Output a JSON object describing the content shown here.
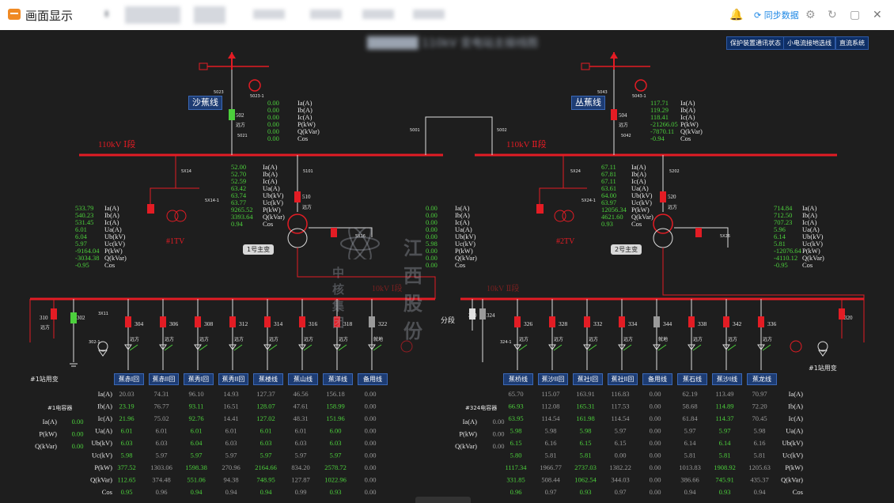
{
  "app": {
    "title": "画面显示"
  },
  "toolbar": {
    "sync_label": "同步数据"
  },
  "top_buttons": [
    "保护装置通讯状态",
    "小电流接地选线",
    "直流系统"
  ],
  "watermark": {
    "main": "江西股份",
    "sub": "中核集团"
  },
  "colors": {
    "bus": "#e31c24",
    "text": "#e6e6e6",
    "value": "#4cd03c",
    "panel": "#1d3c73"
  },
  "lines": {
    "left": "沙蕉线",
    "right": "丛蕉线"
  },
  "bus": {
    "b110_1": "110kV Ⅰ段",
    "b110_2": "110kV Ⅱ段",
    "b10_1": "10kV Ⅰ段",
    "b10_2": "10kV Ⅱ段",
    "section": "分段"
  },
  "tv": {
    "left": "#1TV",
    "right": "#2TV"
  },
  "transformers": {
    "t1": "1号主变",
    "t2": "2号主变"
  },
  "station_xfmr": {
    "left": "#1站用变",
    "right": "#1站用变"
  },
  "capacitor": {
    "left": "#1电容器",
    "right": "#324电容器"
  },
  "measure_labels": [
    "Ia(A)",
    "Ib(A)",
    "Ic(A)",
    "Ua(A)",
    "Ub(kV)",
    "Uc(kV)",
    "P(kW)",
    "Q(kVar)",
    "Cos"
  ],
  "measure_labels_short": [
    "Ia(A)",
    "Ib(A)",
    "Ic(A)",
    "P(kW)",
    "Q(kVar)",
    "Cos"
  ],
  "measure_labels_cap": [
    "Ia(A)",
    "P(kW)",
    "Q(kVar)"
  ],
  "breakers": {
    "b502": "502",
    "b504": "504",
    "b510": "510",
    "b520": "520",
    "b310": "310",
    "b302": "302",
    "b300": "300",
    "b324": "324",
    "b320": "320"
  },
  "switch_labels": {
    "s5023": "5023",
    "s5023_1": "5023-1",
    "s5021": "5021",
    "s5043": "5043",
    "s5043_1": "5043-1",
    "s5042": "5042",
    "s5001": "5001",
    "s5002": "5002",
    "s5x14": "5X14",
    "s5x14_1": "5X14-1",
    "s5x24": "5X24",
    "s5x24_1": "5X24-1",
    "s5101": "5101",
    "s5202": "5202",
    "s5x16": "5X16",
    "s5x26": "5X26",
    "s3x11": "3X11",
    "s302_1": "302-1",
    "s324_1": "324-1"
  },
  "far_label": "远方",
  "ground_label": "就地",
  "values": {
    "v502": [
      "0.00",
      "0.00",
      "0.00",
      "0.00",
      "0.00",
      "0.00"
    ],
    "v504": [
      "117.71",
      "119.29",
      "118.41",
      "-21266.05",
      "-7870.11",
      "-0.94"
    ],
    "v510": [
      "52.00",
      "52.70",
      "52.59",
      "63.42",
      "63.74",
      "63.77",
      "9265.52",
      "3393.64",
      "0.94"
    ],
    "v520": [
      "67.11",
      "67.81",
      "67.11",
      "63.61",
      "64.00",
      "63.97",
      "12056.34",
      "4621.60",
      "0.93"
    ],
    "v_left_low": [
      "533.79",
      "540.23",
      "531.45",
      "6.01",
      "6.04",
      "5.97",
      "-9164.04",
      "-3034.38",
      "-0.95"
    ],
    "v_right_low": [
      "714.84",
      "712.50",
      "707.23",
      "5.96",
      "6.14",
      "5.81",
      "-12076.64",
      "-4110.12",
      "-0.95"
    ],
    "v_mid": [
      "0.00",
      "0.00",
      "0.00",
      "0.00",
      "0.00",
      "5.98",
      "0.00",
      "0.00",
      "0.00"
    ],
    "cap_left": [
      "0.00",
      "0.00",
      "0.00"
    ],
    "cap_right": [
      "0.00",
      "0.00",
      "0.00"
    ]
  },
  "feeders_left": [
    {
      "no": "304",
      "name": "蕉赤I回",
      "state": "远方",
      "vals": [
        "20.03",
        "23.19",
        "21.96",
        "6.01",
        "6.03",
        "5.98",
        "377.52",
        "112.65",
        "0.95"
      ]
    },
    {
      "no": "306",
      "name": "蕉赤II回",
      "state": "远方",
      "vals": [
        "74.31",
        "76.77",
        "75.02",
        "6.01",
        "6.03",
        "5.97",
        "1303.06",
        "374.48",
        "0.96"
      ]
    },
    {
      "no": "308",
      "name": "蕉秀I回",
      "state": "远方",
      "vals": [
        "96.10",
        "93.11",
        "92.76",
        "6.01",
        "6.04",
        "5.97",
        "1598.38",
        "551.06",
        "0.94"
      ]
    },
    {
      "no": "312",
      "name": "蕉秀II回",
      "state": "远方",
      "vals": [
        "14.93",
        "16.51",
        "14.41",
        "6.01",
        "6.03",
        "5.97",
        "270.96",
        "94.38",
        "0.94"
      ]
    },
    {
      "no": "314",
      "name": "蕉楼线",
      "state": "远方",
      "vals": [
        "127.37",
        "128.07",
        "127.02",
        "6.01",
        "6.03",
        "5.97",
        "2164.66",
        "748.95",
        "0.94"
      ]
    },
    {
      "no": "316",
      "name": "蕉山线",
      "state": "远方",
      "vals": [
        "46.56",
        "47.61",
        "48.31",
        "6.01",
        "6.03",
        "5.97",
        "834.20",
        "127.87",
        "0.99"
      ]
    },
    {
      "no": "318",
      "name": "蕉洋线",
      "state": "远方",
      "vals": [
        "156.18",
        "158.99",
        "151.96",
        "6.00",
        "6.03",
        "5.97",
        "2578.72",
        "1022.96",
        "0.93"
      ]
    },
    {
      "no": "322",
      "name": "备用线",
      "state": "就地",
      "vals": [
        "0.00",
        "0.00",
        "0.00",
        "0.00",
        "0.00",
        "0.00",
        "0.00",
        "0.00",
        "0.00"
      ]
    }
  ],
  "feeders_right": [
    {
      "no": "326",
      "name": "蕉桥线",
      "state": "远方",
      "vals": [
        "65.70",
        "66.93",
        "63.95",
        "5.98",
        "6.15",
        "5.80",
        "1117.34",
        "331.85",
        "0.96"
      ]
    },
    {
      "no": "328",
      "name": "蕉沙II回",
      "state": "远方",
      "vals": [
        "115.07",
        "112.08",
        "114.54",
        "5.98",
        "6.16",
        "5.81",
        "1966.77",
        "508.44",
        "0.97"
      ]
    },
    {
      "no": "332",
      "name": "蕉社I回",
      "state": "远方",
      "vals": [
        "163.91",
        "165.31",
        "161.98",
        "5.98",
        "6.15",
        "5.81",
        "2737.03",
        "1062.54",
        "0.93"
      ]
    },
    {
      "no": "334",
      "name": "蕉社II回",
      "state": "远方",
      "vals": [
        "116.83",
        "117.53",
        "114.54",
        "5.97",
        "6.15",
        "0.00",
        "1382.22",
        "344.03",
        "0.97"
      ]
    },
    {
      "no": "344",
      "name": "备用线",
      "state": "就地",
      "vals": [
        "0.00",
        "0.00",
        "0.00",
        "0.00",
        "0.00",
        "0.00",
        "0.00",
        "0.00",
        "0.00"
      ]
    },
    {
      "no": "338",
      "name": "蕉石线",
      "state": "远方",
      "vals": [
        "62.19",
        "58.68",
        "61.84",
        "5.97",
        "6.14",
        "5.81",
        "1013.83",
        "386.66",
        "0.94"
      ]
    },
    {
      "no": "342",
      "name": "蕉沙I线",
      "state": "远方",
      "vals": [
        "113.49",
        "114.89",
        "114.37",
        "5.97",
        "6.14",
        "5.81",
        "1908.92",
        "745.91",
        "0.93"
      ]
    },
    {
      "no": "336",
      "name": "蕉龙线",
      "state": "远方",
      "vals": [
        "70.97",
        "72.20",
        "70.45",
        "5.98",
        "6.16",
        "5.81",
        "1205.63",
        "435.37",
        "0.94"
      ]
    }
  ]
}
